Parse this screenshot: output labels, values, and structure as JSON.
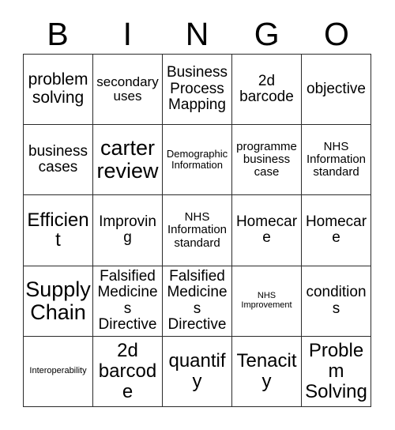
{
  "card": {
    "title": "BINGO",
    "header_letters": [
      "B",
      "I",
      "N",
      "G",
      "O"
    ],
    "grid_size": "5x5",
    "border_color": "#2b2b2b",
    "background_color": "#ffffff",
    "text_color": "#000000"
  },
  "cells": [
    [
      {
        "label": "problem solving",
        "size": "lg"
      },
      {
        "label": "secondary uses",
        "size": "sm"
      },
      {
        "label": "Business Process Mapping",
        "size": "md"
      },
      {
        "label": "2d barcode",
        "size": "md"
      },
      {
        "label": "objective",
        "size": "md"
      }
    ],
    [
      {
        "label": "business cases",
        "size": "md"
      },
      {
        "label": "carter review",
        "size": "xxl"
      },
      {
        "label": "Demographic Information",
        "size": "xxs"
      },
      {
        "label": "programme business case",
        "size": "xs"
      },
      {
        "label": "NHS Information standard",
        "size": "xs"
      }
    ],
    [
      {
        "label": "Efficient",
        "size": "xl"
      },
      {
        "label": "Improving",
        "size": "md"
      },
      {
        "label": "NHS Information standard",
        "size": "xs"
      },
      {
        "label": "Homecare",
        "size": "md"
      },
      {
        "label": "Homecare",
        "size": "md"
      }
    ],
    [
      {
        "label": "Supply Chain",
        "size": "xxl"
      },
      {
        "label": "Falsified Medicines Directive",
        "size": "md"
      },
      {
        "label": "Falsified Medicines Directive",
        "size": "md"
      },
      {
        "label": "NHS Improvement",
        "size": "tiny"
      },
      {
        "label": "conditions",
        "size": "md"
      }
    ],
    [
      {
        "label": "Interoperability",
        "size": "tiny"
      },
      {
        "label": "2d barcode",
        "size": "xl"
      },
      {
        "label": "quantify",
        "size": "xl"
      },
      {
        "label": "Tenacity",
        "size": "xl"
      },
      {
        "label": "Problem Solving",
        "size": "xl"
      }
    ]
  ]
}
